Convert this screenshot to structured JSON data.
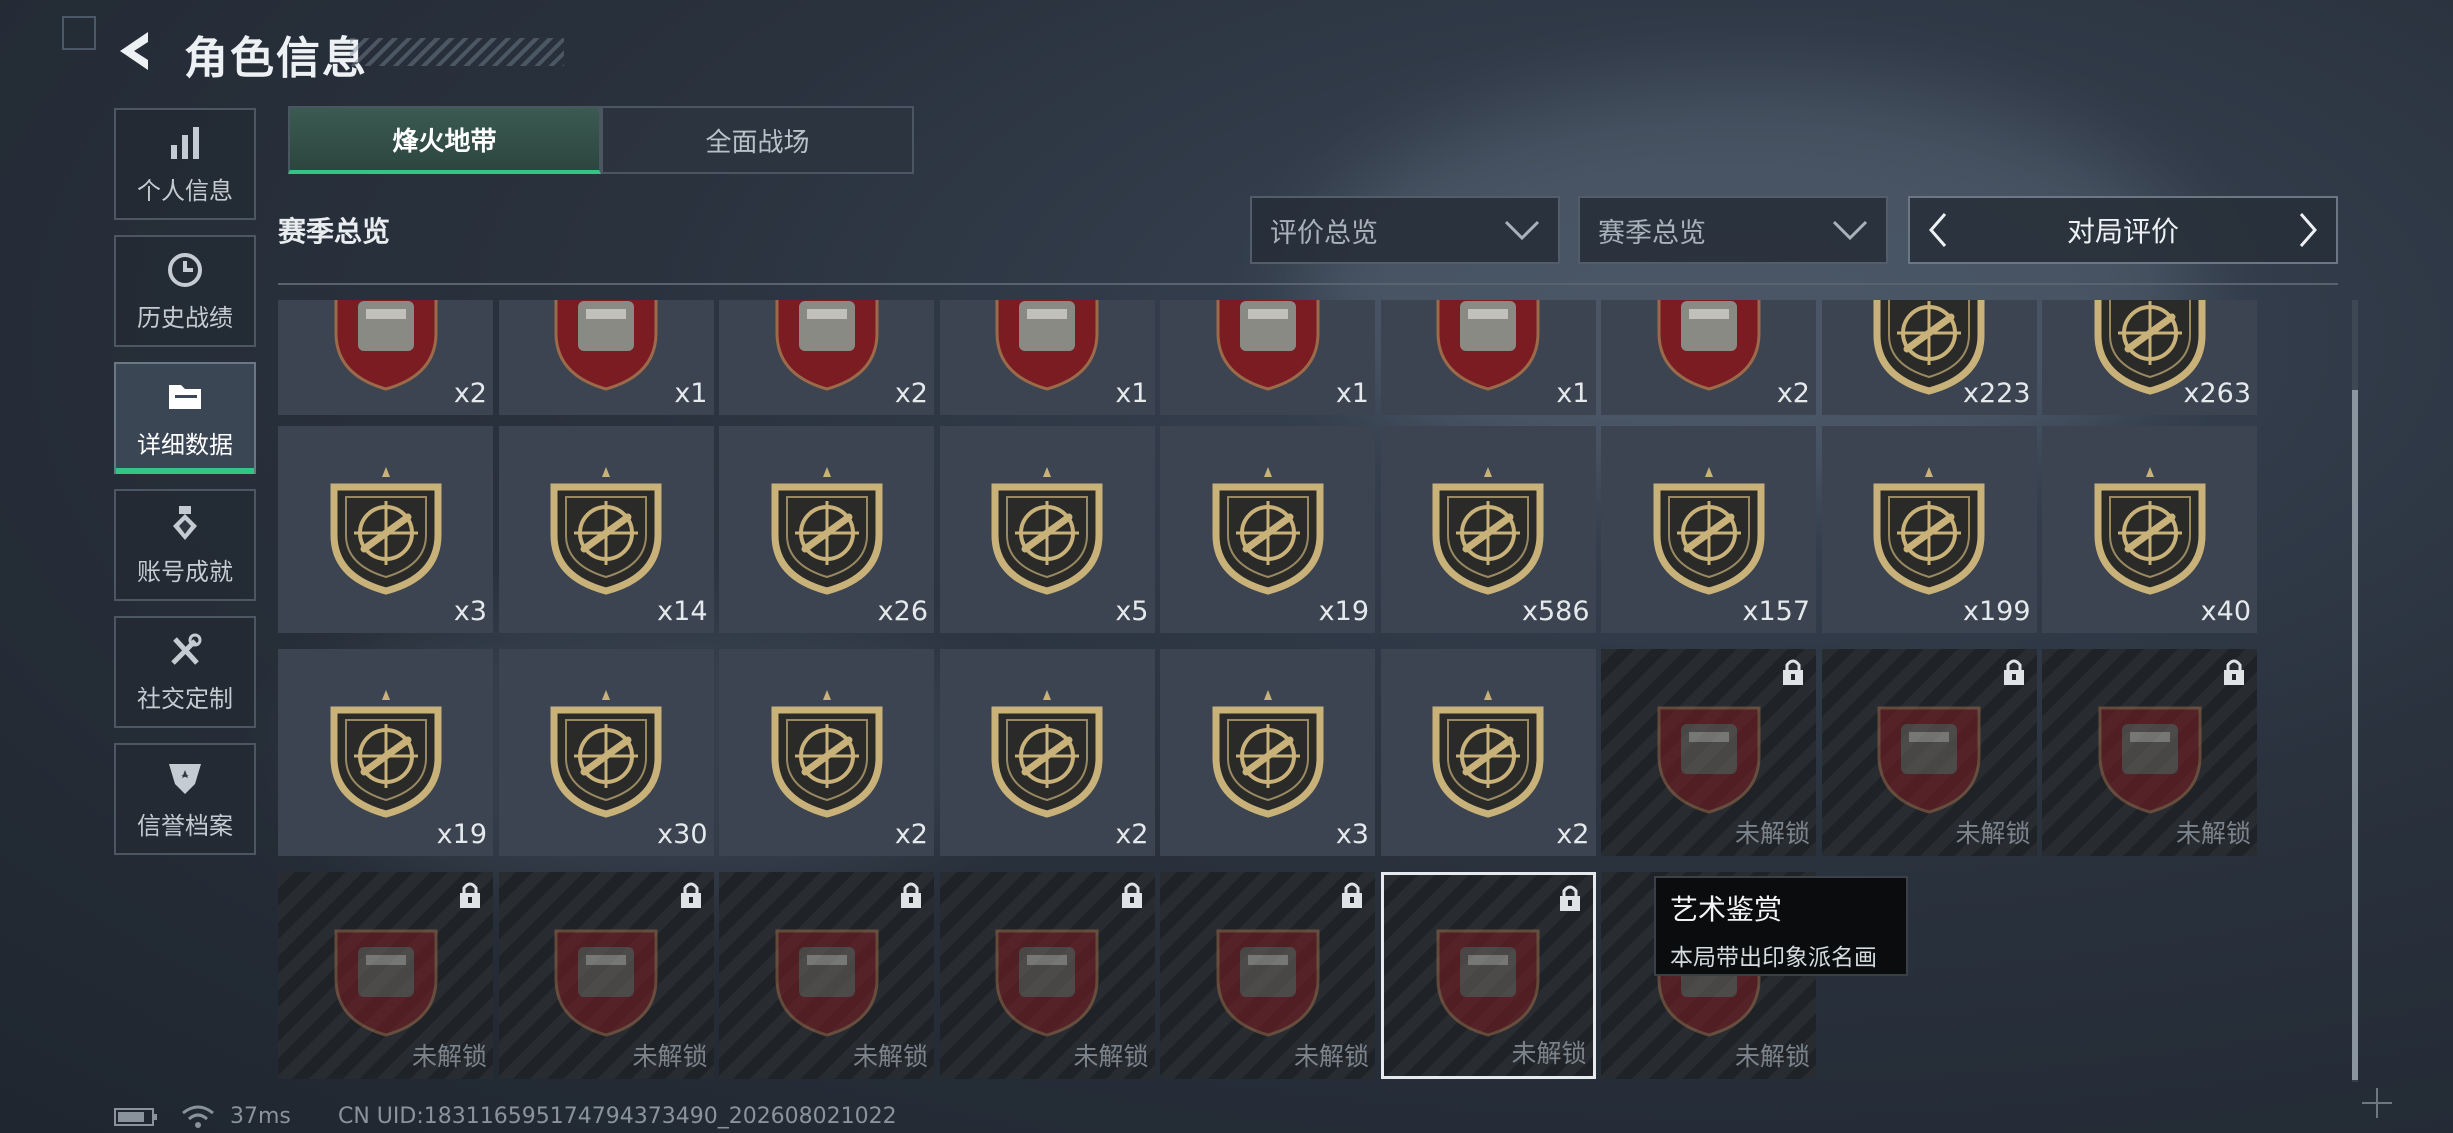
{
  "header": {
    "title": "角色信息"
  },
  "sidebar": {
    "items": [
      {
        "label": "个人信息",
        "icon": "bar-chart-icon",
        "active": false
      },
      {
        "label": "历史战绩",
        "icon": "clock-history-icon",
        "active": false
      },
      {
        "label": "详细数据",
        "icon": "folder-icon",
        "active": true
      },
      {
        "label": "账号成就",
        "icon": "medal-icon",
        "active": false
      },
      {
        "label": "社交定制",
        "icon": "tools-icon",
        "active": false
      },
      {
        "label": "信誉档案",
        "icon": "shield-star-icon",
        "active": false
      }
    ]
  },
  "tabs": [
    {
      "label": "烽火地带",
      "active": true
    },
    {
      "label": "全面战场",
      "active": false
    }
  ],
  "section": {
    "title": "赛季总览"
  },
  "filters": {
    "dropdown1": "评价总览",
    "dropdown2": "赛季总览",
    "pager_label": "对局评价"
  },
  "badges": {
    "row1": [
      "x2",
      "x1",
      "x2",
      "x1",
      "x1",
      "x1",
      "x2",
      "x223",
      "x263"
    ],
    "row2": [
      "x3",
      "x14",
      "x26",
      "x5",
      "x19",
      "x586",
      "x157",
      "x199",
      "x40"
    ],
    "row3": [
      "x19",
      "x30",
      "x2",
      "x2",
      "x3",
      "x2",
      "未解锁",
      "未解锁",
      "未解锁"
    ],
    "row4": [
      "未解锁",
      "未解锁",
      "未解锁",
      "未解锁",
      "未解锁",
      "未解锁",
      "未解锁"
    ]
  },
  "tooltip": {
    "title": "艺术鉴赏",
    "desc": "本局带出印象派名画"
  },
  "status": {
    "ping": "37ms",
    "uid": "CN UID:18311659517479437349​0_202608021022"
  },
  "colors": {
    "accent": "#34c485",
    "gold": "#c9b27a",
    "crimson": "#7a1c22"
  }
}
